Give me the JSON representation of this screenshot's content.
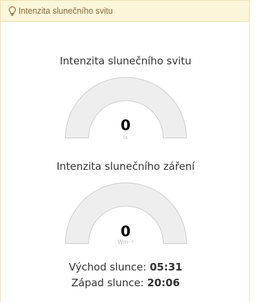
{
  "panel": {
    "icon": "lightbulb-icon",
    "title": "Intenzita slunečního svitu"
  },
  "gauges": [
    {
      "title": "Intenzita slunečního svitu",
      "value": "0",
      "unit": "lx",
      "fill_fraction": 0
    },
    {
      "title": "Intenzita slunečního záření",
      "value": "0",
      "unit": "Wm⁻²",
      "fill_fraction": 0
    }
  ],
  "sun": {
    "sunrise_label": "Východ slunce:",
    "sunrise_time": "05:31",
    "sunset_label": "Západ slunce:",
    "sunset_time": "20:06"
  },
  "colors": {
    "heading_bg": "#fbf5d9",
    "heading_text": "#8a6d3b",
    "gauge_track": "#eeeeee",
    "gauge_border": "#cccccc"
  }
}
